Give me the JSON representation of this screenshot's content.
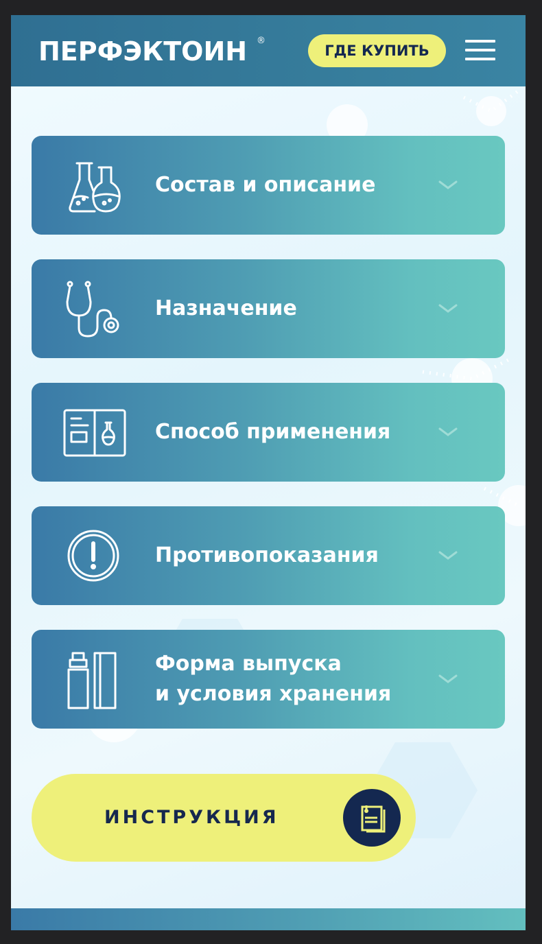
{
  "header": {
    "logo_text": "ПЕРФЭКТОИН",
    "logo_reg": "®",
    "buy_label": "ГДЕ КУПИТЬ",
    "menu_icon": "hamburger-menu-icon"
  },
  "accordion": [
    {
      "lines": [
        "Состав и описание"
      ],
      "icon": "flasks-icon"
    },
    {
      "lines": [
        "Назначение"
      ],
      "icon": "stethoscope-icon"
    },
    {
      "lines": [
        "Способ применения"
      ],
      "icon": "instruction-booklet-icon"
    },
    {
      "lines": [
        "Противопоказания"
      ],
      "icon": "exclamation-circle-icon"
    },
    {
      "lines": [
        "Форма выпуска",
        "и условия хранения"
      ],
      "icon": "package-tube-icon"
    }
  ],
  "instruction": {
    "label": "ИНСТРУКЦИЯ",
    "icon": "document-icon"
  },
  "colors": {
    "header_bg": "#347699",
    "accent_yellow": "#eef07a",
    "navy": "#142850",
    "card_start": "#3a7aa7",
    "card_end": "#69c8c0"
  }
}
